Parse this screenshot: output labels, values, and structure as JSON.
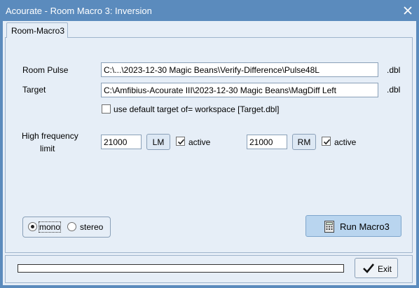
{
  "window": {
    "title": "Acourate - Room Macro 3: Inversion"
  },
  "tab": {
    "label": "Room-Macro3"
  },
  "room_pulse": {
    "label": "Room Pulse",
    "value": "C:\\...\\2023-12-30 Magic Beans\\Verify-Difference\\Pulse48L",
    "ext": ".dbl"
  },
  "target": {
    "label": "Target",
    "value": "C:\\Amfibius-Acourate III\\2023-12-30 Magic Beans\\MagDiff Left",
    "ext": ".dbl"
  },
  "default_target": {
    "label": "use default target of= workspace [Target.dbl]",
    "checked": false
  },
  "hf_limit": {
    "label_line1": "High frequency",
    "label_line2": "limit",
    "left": {
      "value": "21000",
      "button": "LM",
      "active_label": "active",
      "active_checked": true
    },
    "right": {
      "value": "21000",
      "button": "RM",
      "active_label": "active",
      "active_checked": true
    }
  },
  "mode": {
    "mono_label": "mono",
    "stereo_label": "stereo",
    "selected": "mono"
  },
  "run_button": {
    "label": "Run Macro3",
    "icon": "calculator-icon"
  },
  "progress": {
    "value": 0
  },
  "exit_button": {
    "label": "Exit",
    "icon": "checkmark-icon"
  }
}
